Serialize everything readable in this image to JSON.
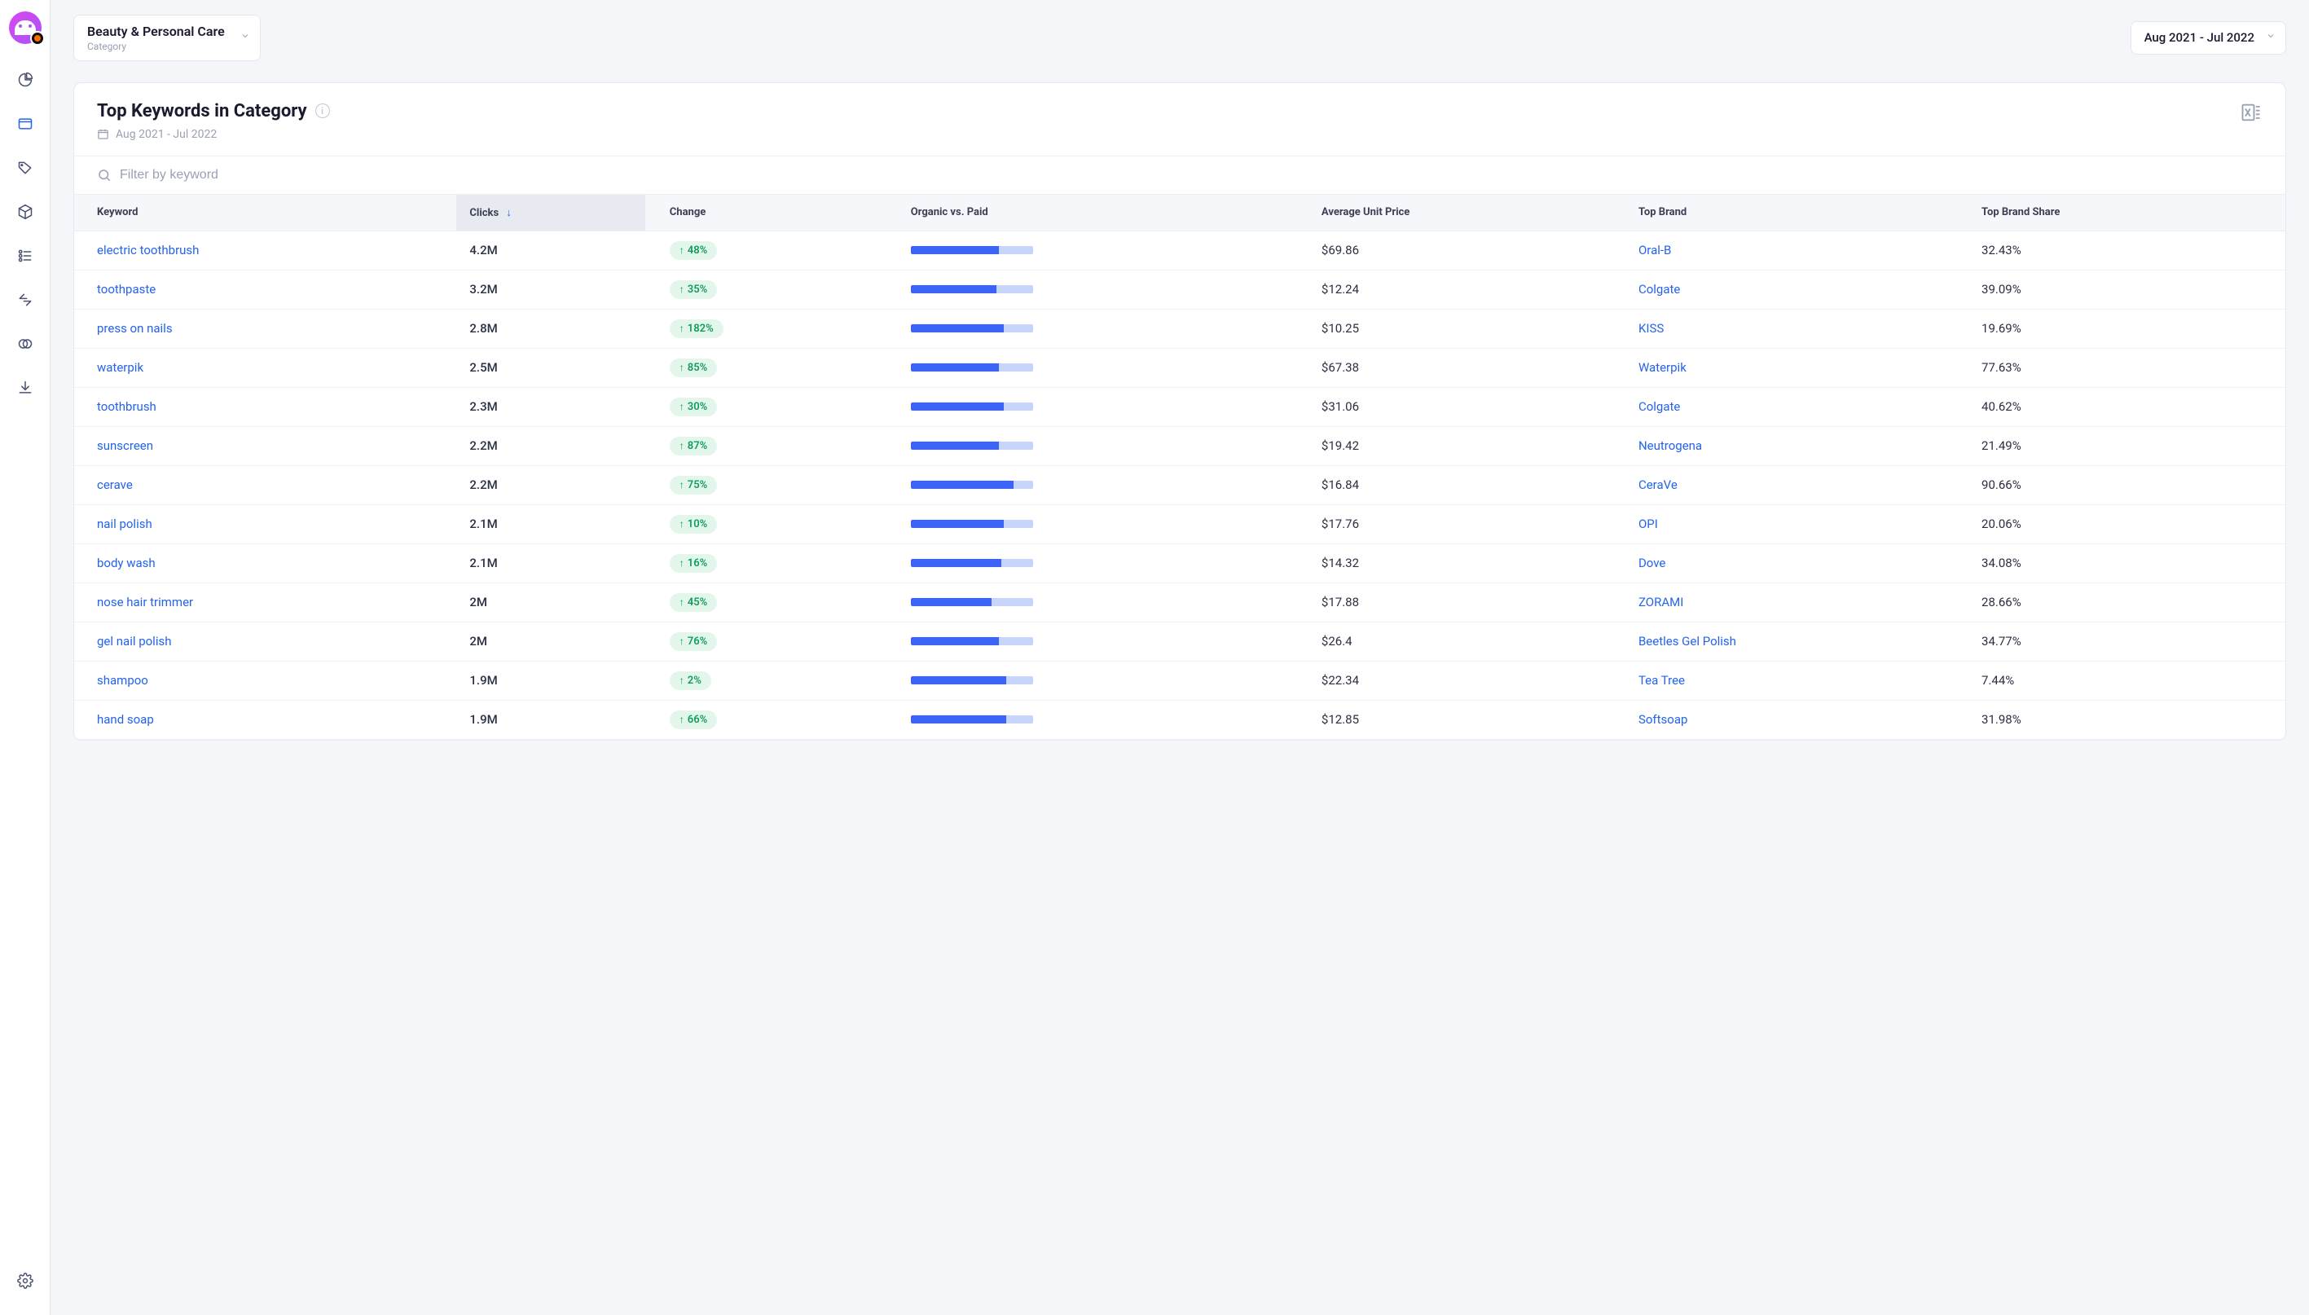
{
  "sidebar": {
    "items": [
      "pie",
      "window",
      "tag",
      "cube",
      "list",
      "arrows",
      "venn",
      "download"
    ],
    "activeIndex": 1
  },
  "topbar": {
    "category": {
      "label": "Beauty & Personal Care",
      "sublabel": "Category"
    },
    "dateRange": "Aug 2021 - Jul 2022"
  },
  "panel": {
    "title": "Top Keywords in Category",
    "dateRange": "Aug 2021 - Jul 2022",
    "filterPlaceholder": "Filter by keyword"
  },
  "table": {
    "headers": {
      "keyword": "Keyword",
      "clicks": "Clicks",
      "change": "Change",
      "ovp": "Organic vs. Paid",
      "price": "Average Unit Price",
      "brand": "Top Brand",
      "share": "Top Brand Share"
    },
    "sortColumn": "clicks",
    "sortDirection": "desc",
    "rows": [
      {
        "keyword": "electric toothbrush",
        "clicks": "4.2M",
        "change": "48%",
        "changeDir": "up",
        "ovpOrganic": 72,
        "price": "$69.86",
        "brand": "Oral-B",
        "share": "32.43%"
      },
      {
        "keyword": "toothpaste",
        "clicks": "3.2M",
        "change": "35%",
        "changeDir": "up",
        "ovpOrganic": 70,
        "price": "$12.24",
        "brand": "Colgate",
        "share": "39.09%"
      },
      {
        "keyword": "press on nails",
        "clicks": "2.8M",
        "change": "182%",
        "changeDir": "up",
        "ovpOrganic": 76,
        "price": "$10.25",
        "brand": "KISS",
        "share": "19.69%"
      },
      {
        "keyword": "waterpik",
        "clicks": "2.5M",
        "change": "85%",
        "changeDir": "up",
        "ovpOrganic": 72,
        "price": "$67.38",
        "brand": "Waterpik",
        "share": "77.63%"
      },
      {
        "keyword": "toothbrush",
        "clicks": "2.3M",
        "change": "30%",
        "changeDir": "up",
        "ovpOrganic": 76,
        "price": "$31.06",
        "brand": "Colgate",
        "share": "40.62%"
      },
      {
        "keyword": "sunscreen",
        "clicks": "2.2M",
        "change": "87%",
        "changeDir": "up",
        "ovpOrganic": 72,
        "price": "$19.42",
        "brand": "Neutrogena",
        "share": "21.49%"
      },
      {
        "keyword": "cerave",
        "clicks": "2.2M",
        "change": "75%",
        "changeDir": "up",
        "ovpOrganic": 84,
        "price": "$16.84",
        "brand": "CeraVe",
        "share": "90.66%"
      },
      {
        "keyword": "nail polish",
        "clicks": "2.1M",
        "change": "10%",
        "changeDir": "up",
        "ovpOrganic": 76,
        "price": "$17.76",
        "brand": "OPI",
        "share": "20.06%"
      },
      {
        "keyword": "body wash",
        "clicks": "2.1M",
        "change": "16%",
        "changeDir": "up",
        "ovpOrganic": 74,
        "price": "$14.32",
        "brand": "Dove",
        "share": "34.08%"
      },
      {
        "keyword": "nose hair trimmer",
        "clicks": "2M",
        "change": "45%",
        "changeDir": "up",
        "ovpOrganic": 66,
        "price": "$17.88",
        "brand": "ZORAMI",
        "share": "28.66%"
      },
      {
        "keyword": "gel nail polish",
        "clicks": "2M",
        "change": "76%",
        "changeDir": "up",
        "ovpOrganic": 72,
        "price": "$26.4",
        "brand": "Beetles Gel Polish",
        "share": "34.77%"
      },
      {
        "keyword": "shampoo",
        "clicks": "1.9M",
        "change": "2%",
        "changeDir": "up",
        "ovpOrganic": 78,
        "price": "$22.34",
        "brand": "Tea Tree",
        "share": "7.44%"
      },
      {
        "keyword": "hand soap",
        "clicks": "1.9M",
        "change": "66%",
        "changeDir": "up",
        "ovpOrganic": 78,
        "price": "$12.85",
        "brand": "Softsoap",
        "share": "31.98%"
      }
    ]
  }
}
